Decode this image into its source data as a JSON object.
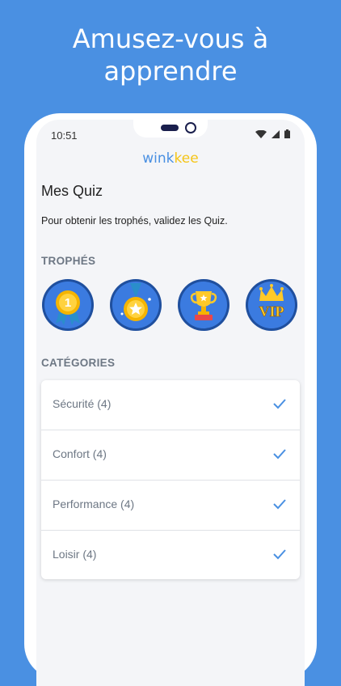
{
  "headline": {
    "line1": "Amusez-vous à",
    "line2": "apprendre"
  },
  "status": {
    "time": "10:51"
  },
  "logo": {
    "part1": "wink",
    "part2": "kee"
  },
  "page": {
    "title": "Mes Quiz",
    "subtitle": "Pour obtenir les trophés, validez les Quiz."
  },
  "trophies": {
    "header": "TROPHÉS",
    "items": [
      {
        "icon": "medal-number-one-icon",
        "text": "1"
      },
      {
        "icon": "medal-star-icon"
      },
      {
        "icon": "trophy-cup-icon"
      },
      {
        "icon": "vip-crown-icon",
        "text": "VIP"
      }
    ]
  },
  "categories": {
    "header": "CATÉGORIES",
    "items": [
      {
        "label": "Sécurité (4)",
        "checked": true
      },
      {
        "label": "Confort (4)",
        "checked": true
      },
      {
        "label": "Performance (4)",
        "checked": true
      },
      {
        "label": "Loisir (4)",
        "checked": true
      }
    ]
  },
  "colors": {
    "background": "#4a90e2",
    "accent": "#4a90e2",
    "gold": "#f5c518",
    "badge_blue": "#2f6fd1"
  }
}
